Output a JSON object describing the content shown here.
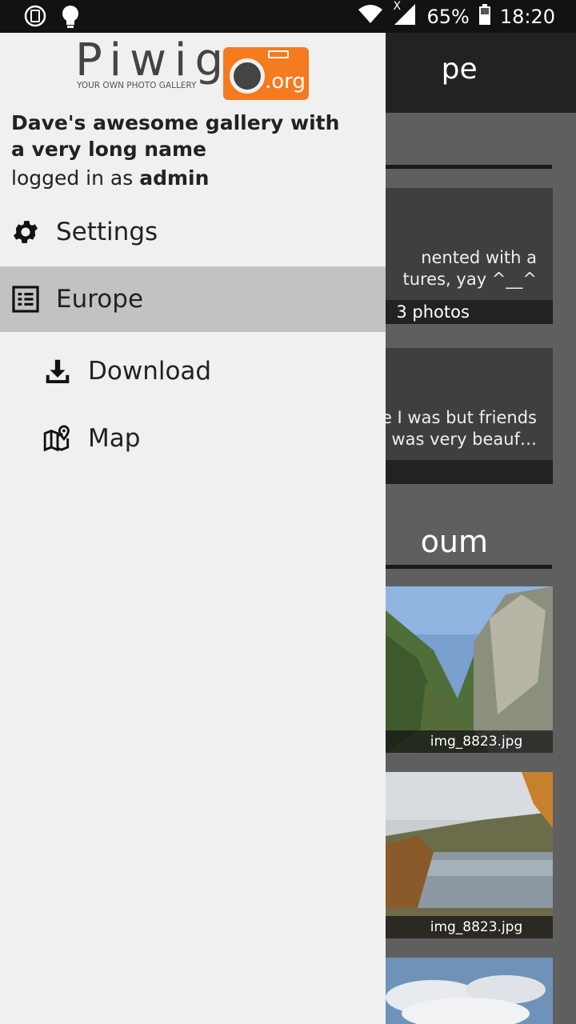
{
  "status_bar": {
    "battery": "65%",
    "time": "18:20",
    "network_indicator": "X"
  },
  "background": {
    "app_title_partial": "pe",
    "cards": [
      {
        "desc_line1": "nented with a",
        "desc_line2": "tures, yay ^__^",
        "footer": "3 photos"
      },
      {
        "desc_line1": "e I was but friends",
        "desc_line2": "was very beauf…",
        "footer": ""
      }
    ],
    "section_title_partial": "oum",
    "thumbnails": [
      {
        "caption": "img_8823.jpg"
      },
      {
        "caption": "img_8823.jpg"
      },
      {
        "caption": ""
      }
    ]
  },
  "drawer": {
    "logo": {
      "wordmark": "Piwig",
      "tagline": "YOUR OWN PHOTO GALLERY",
      "suffix": ".org"
    },
    "gallery_name": "Dave's awesome gallery with a very long name",
    "login_prefix": "logged in as",
    "username": "admin",
    "items": [
      {
        "label": "Settings",
        "icon": "gear-icon"
      },
      {
        "label": "Europe",
        "icon": "album-list-icon"
      },
      {
        "label": "Download",
        "icon": "download-icon"
      },
      {
        "label": "Map",
        "icon": "map-pin-icon"
      }
    ]
  },
  "colors": {
    "drawer_bg": "#f0f0f0",
    "active_item_bg": "#c2c2c2",
    "logo_orange": "#f47b20",
    "app_bar": "#222222"
  }
}
